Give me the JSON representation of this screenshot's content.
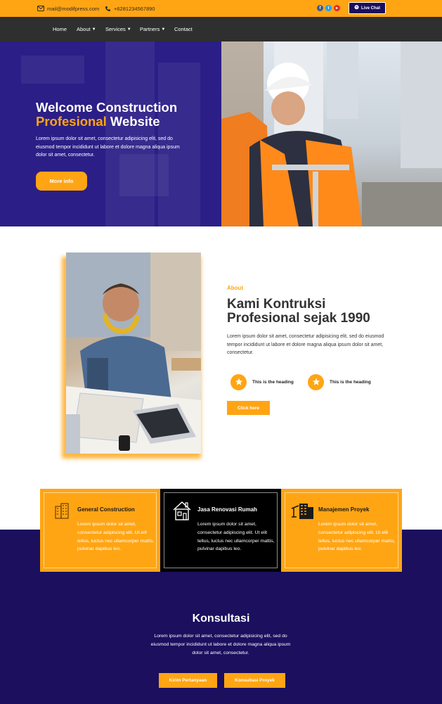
{
  "topbar": {
    "email": "mail@modifpress.com",
    "phone": "+6281234567890",
    "live_chat": "Live Chat",
    "colors": {
      "background": "#FFA514",
      "live_chat_bg": "#1B0F5E"
    },
    "social_icons": [
      "facebook-icon",
      "twitter-icon",
      "youtube-icon"
    ]
  },
  "nav": {
    "items": [
      {
        "label": "Home",
        "dropdown": false
      },
      {
        "label": "About",
        "dropdown": true
      },
      {
        "label": "Services",
        "dropdown": true
      },
      {
        "label": "Partners",
        "dropdown": true
      },
      {
        "label": "Contact",
        "dropdown": false
      }
    ]
  },
  "hero": {
    "title_line1": "Welcome Construction",
    "title_accent": "Profesional",
    "title_rest": " Website",
    "subtitle": "Lorem ipsum dolor sit amet, consectetur adipisicing elit, sed do eiusmod tempor incididunt ut labore et dolore magna aliqua ipsum dolor sit amet, consectetur.",
    "button": "More info"
  },
  "about": {
    "label": "About",
    "title": "Kami Kontruksi Profesional sejak 1990",
    "text": "Lorem ipsum dolor sit amet, consectetur adipisicing elit, sed do eiusmod tempor incididunt ut labore et dolore magna aliqua ipsum dolor sit amet, consectetur.",
    "features": [
      "This is the heading",
      "This is the heading"
    ],
    "button": "Click here"
  },
  "services": [
    {
      "title": "General Construction",
      "text": "Lorem ipsum dolor sit amet, consectetur adipiscing elit. Ut elit tellus, luctus nec ullamcorper mattis, pulvinar dapibus leo.",
      "icon": "building-icon"
    },
    {
      "title": "Jasa Renovasi Rumah",
      "text": "Lorem ipsum dolor sit amet, consectetur adipiscing elit. Ut elit tellus, luctus nec ullamcorper mattis, pulvinar dapibus leo.",
      "icon": "house-icon"
    },
    {
      "title": "Manajemen Proyek",
      "text": "Lorem ipsum dolor sit amet, consectetur adipiscing elit. Ut elit tellus, luctus nec ullamcorper mattis, pulvinar dapibus leo.",
      "icon": "crane-building-icon"
    }
  ],
  "konsultasi": {
    "title": "Konsultasi",
    "text": "Lorem ipsum dolor sit amet, consectetur adipisicing elit, sed do eiusmod tempor incididunt ut labore et dolore magna aliqua ipsum dolor sit amet, consectetur.",
    "buttons": [
      "Kirim Pertanyaan",
      "Konsultasi Proyek"
    ]
  },
  "colors": {
    "accent": "#FFA514",
    "primary_dark": "#1B0F5E",
    "nav_bg": "#2F2F2F"
  }
}
